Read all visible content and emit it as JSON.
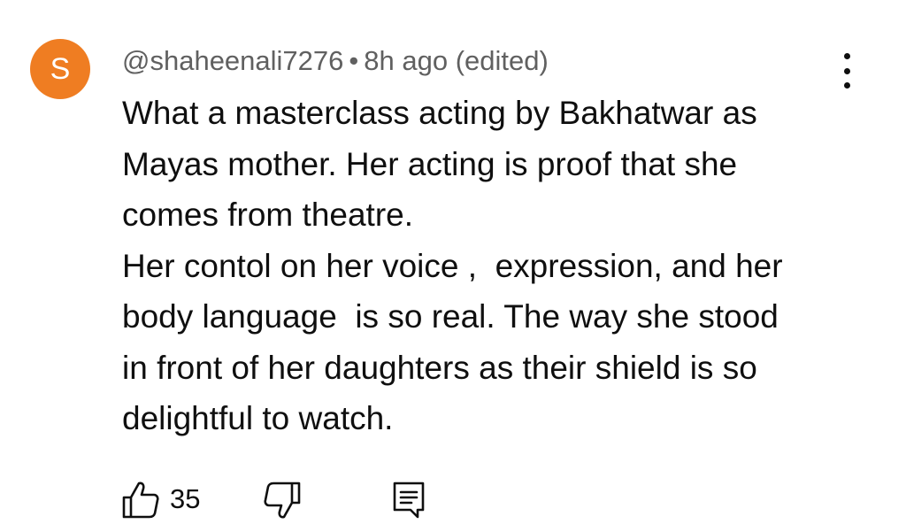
{
  "comment": {
    "avatar_letter": "S",
    "avatar_color": "#ef7d22",
    "author": "@shaheenali7276",
    "separator": "•",
    "timestamp": "8h ago",
    "edited_label": "(edited)",
    "lines": [
      "What a masterclass acting by Bakhatwar as",
      "Mayas mother. Her acting is proof that she",
      "comes from theatre.",
      "Her contol on her voice ,  expression, and her",
      "body language  is so real. The way she stood",
      "in front of her daughters as their shield is so",
      "delightful to watch."
    ],
    "like_count": "35"
  },
  "icons": {
    "more": "more-vertical-icon",
    "like": "thumbs-up-icon",
    "dislike": "thumbs-down-icon",
    "reply": "reply-comment-icon"
  }
}
